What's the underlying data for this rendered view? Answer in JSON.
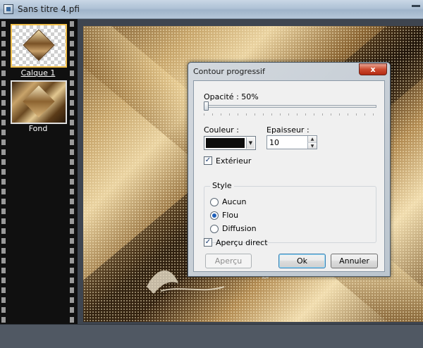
{
  "window": {
    "title": "Sans titre 4.pfi"
  },
  "layers": [
    {
      "label": "Calque 1",
      "selected": true
    },
    {
      "label": "Fond",
      "selected": false
    }
  ],
  "dialog": {
    "title": "Contour progressif",
    "close_glyph": "x",
    "opacity": {
      "label": "Opacité : 50%",
      "value_percent": 50
    },
    "color": {
      "label": "Couleur :",
      "value": "#0d0d0d",
      "dropdown_glyph": "▼"
    },
    "thickness": {
      "label": "Epaisseur :",
      "value": "10",
      "up_glyph": "▲",
      "down_glyph": "▼"
    },
    "exterior": {
      "label": "Extérieur",
      "checked": true
    },
    "style": {
      "legend": "Style",
      "options": [
        {
          "label": "Aucun",
          "selected": false
        },
        {
          "label": "Flou",
          "selected": true
        },
        {
          "label": "Diffusion",
          "selected": false
        }
      ]
    },
    "live_preview": {
      "label": "Aperçu direct",
      "checked": true
    },
    "buttons": {
      "preview": "Aperçu",
      "ok": "Ok",
      "cancel": "Annuler"
    }
  },
  "watermark": {
    "text": "Manany"
  },
  "colors": {
    "close_button": "#cc4a2f",
    "radio_accent": "#1f5fb8",
    "selected_layer_border": "#f2c04c"
  }
}
